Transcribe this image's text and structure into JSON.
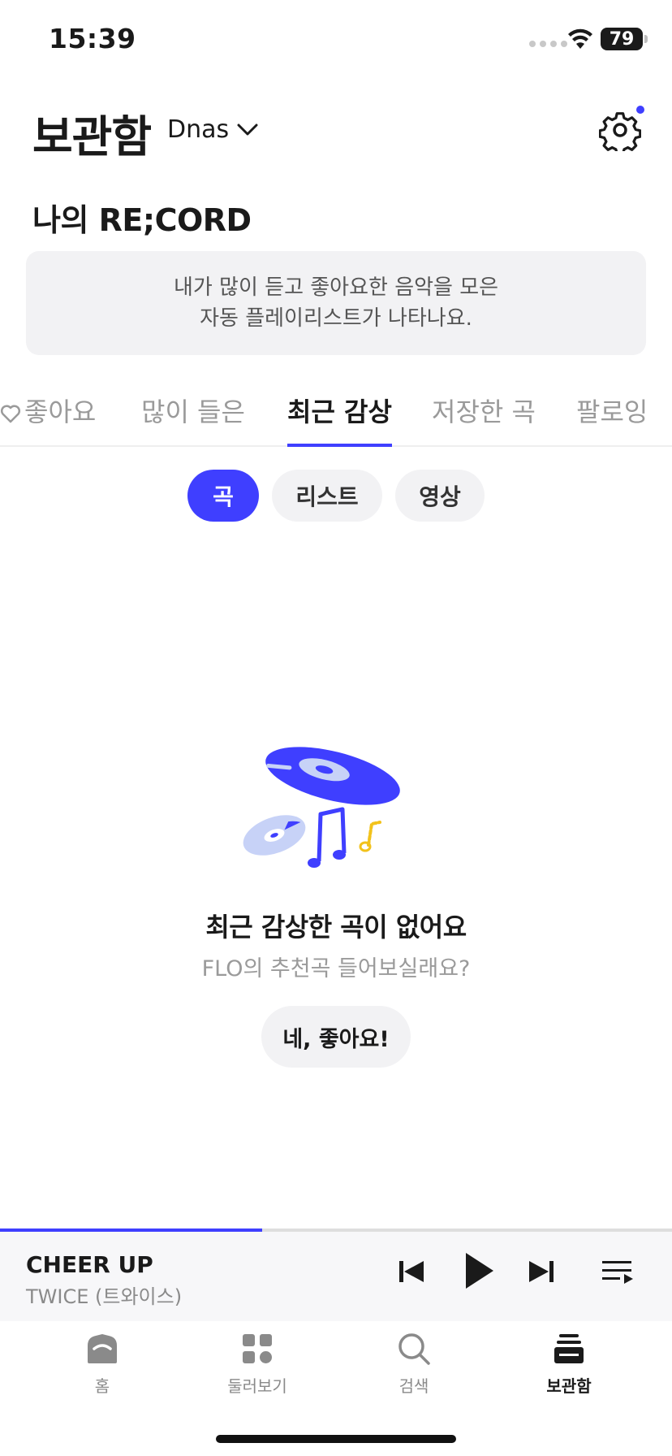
{
  "status_bar": {
    "time": "15:39",
    "battery": "79"
  },
  "header": {
    "title": "보관함",
    "profile": "Dnas"
  },
  "record": {
    "title": "나의 RE;CORD",
    "desc_line1": "내가 많이 듣고 좋아요한 음악을 모은",
    "desc_line2": "자동 플레이리스트가 나타나요."
  },
  "tabs": [
    {
      "label": "좋아요",
      "active": false
    },
    {
      "label": "많이 들은",
      "active": false
    },
    {
      "label": "최근 감상",
      "active": true
    },
    {
      "label": "저장한 곡",
      "active": false
    },
    {
      "label": "팔로잉",
      "active": false
    }
  ],
  "chips": [
    {
      "label": "곡",
      "active": true
    },
    {
      "label": "리스트",
      "active": false
    },
    {
      "label": "영상",
      "active": false
    }
  ],
  "empty": {
    "title": "최근 감상한 곡이 없어요",
    "subtitle": "FLO의 추천곡 들어보실래요?",
    "button": "네, 좋아요!"
  },
  "player": {
    "title": "CHEER UP",
    "artist": "TWICE (트와이스)",
    "progress": 0.39
  },
  "nav": [
    {
      "label": "홈",
      "icon": "home-icon",
      "active": false
    },
    {
      "label": "둘러보기",
      "icon": "browse-icon",
      "active": false
    },
    {
      "label": "검색",
      "icon": "search-icon",
      "active": false
    },
    {
      "label": "보관함",
      "icon": "library-icon",
      "active": true
    }
  ],
  "colors": {
    "accent": "#3f3fff",
    "illustration_light": "#c7d2f7",
    "illustration_yellow": "#f2c21b"
  }
}
